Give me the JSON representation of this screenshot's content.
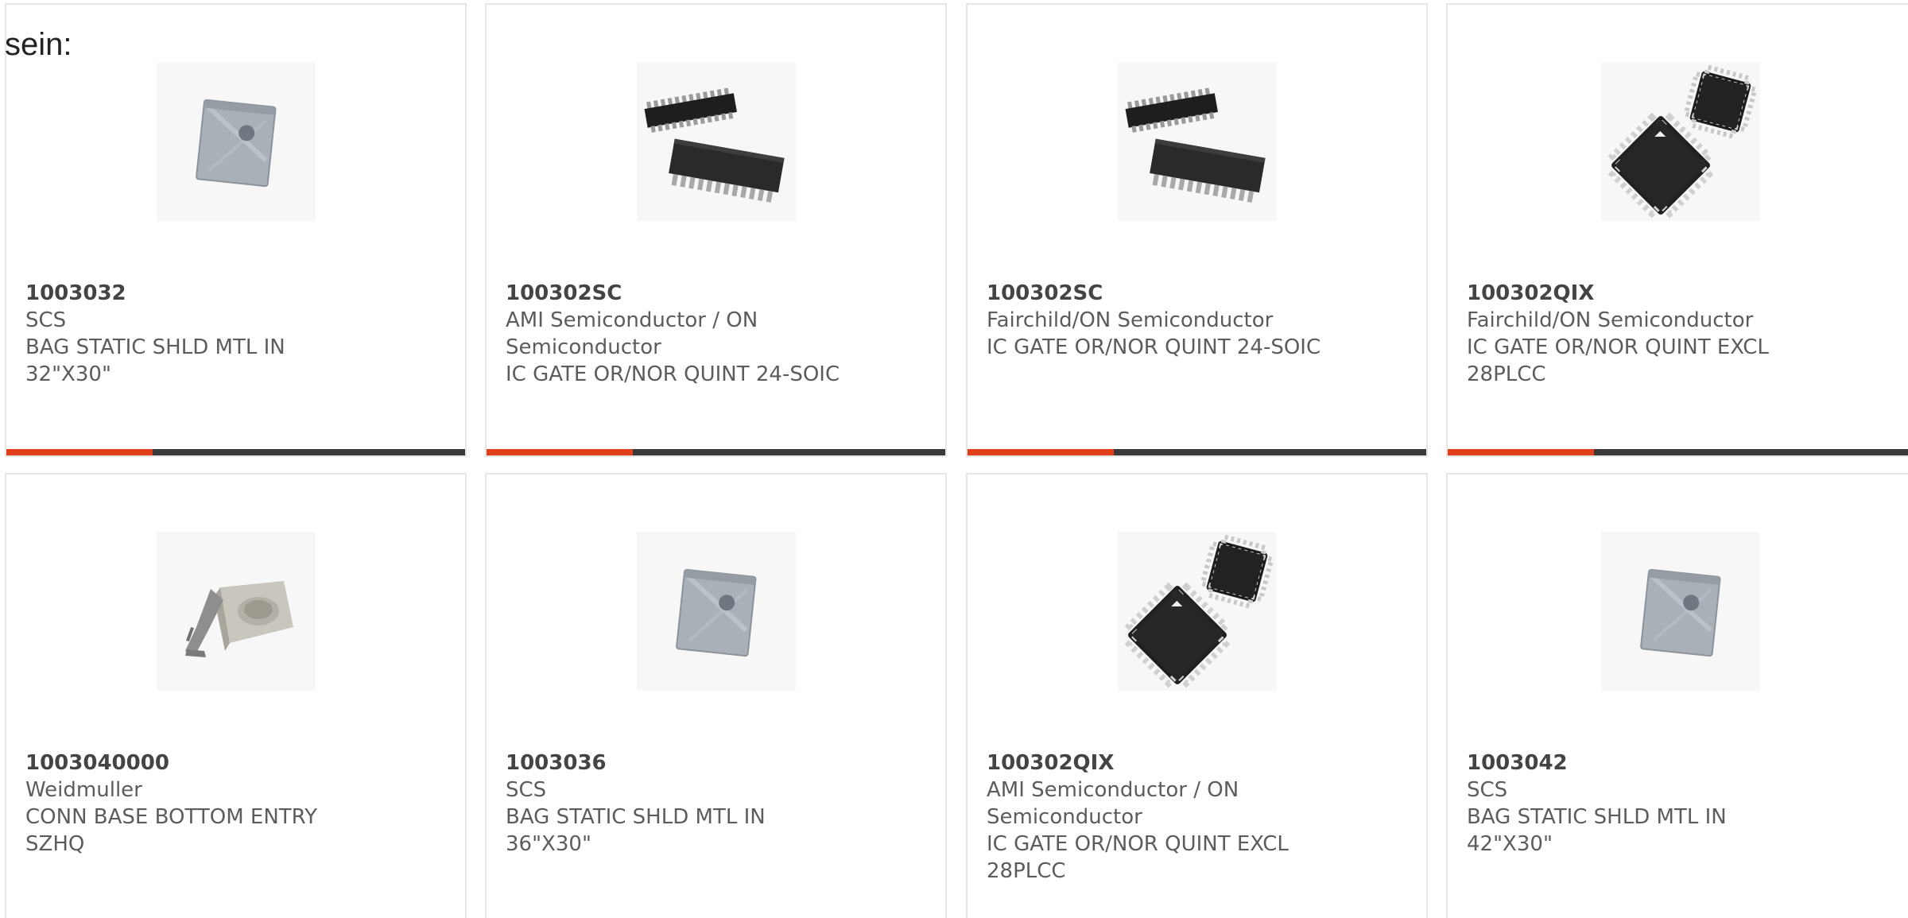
{
  "lead_text": "sein:",
  "colors": {
    "accent": "#e2401c",
    "bar": "#3a3a3a",
    "border": "#e6e6e6"
  },
  "products": [
    {
      "part_number": "1003032",
      "manufacturer": "SCS",
      "description": [
        "BAG STATIC SHLD MTL IN",
        "32\"X30\""
      ],
      "image_icon": "static-bag-icon"
    },
    {
      "part_number": "100302SC",
      "manufacturer": "AMI Semiconductor / ON Semiconductor",
      "description": [
        "IC GATE OR/NOR QUINT 24-SOIC"
      ],
      "image_icon": "soic-chip-icon"
    },
    {
      "part_number": "100302SC",
      "manufacturer": "Fairchild/ON Semiconductor",
      "description": [
        "IC GATE OR/NOR QUINT 24-SOIC"
      ],
      "image_icon": "soic-chip-icon"
    },
    {
      "part_number": "100302QIX",
      "manufacturer": "Fairchild/ON Semiconductor",
      "description": [
        "IC GATE OR/NOR QUINT EXCL",
        "28PLCC"
      ],
      "image_icon": "plcc-chip-icon"
    },
    {
      "part_number": "1003040000",
      "manufacturer": "Weidmuller",
      "description": [
        "CONN BASE BOTTOM ENTRY",
        "SZHQ"
      ],
      "image_icon": "connector-base-icon"
    },
    {
      "part_number": "1003036",
      "manufacturer": "SCS",
      "description": [
        "BAG STATIC SHLD MTL IN",
        "36\"X30\""
      ],
      "image_icon": "static-bag-icon"
    },
    {
      "part_number": "100302QIX",
      "manufacturer": "AMI Semiconductor / ON Semiconductor",
      "description": [
        "IC GATE OR/NOR QUINT EXCL",
        "28PLCC"
      ],
      "image_icon": "plcc-chip-icon"
    },
    {
      "part_number": "1003042",
      "manufacturer": "SCS",
      "description": [
        "BAG STATIC SHLD MTL IN",
        "42\"X30\""
      ],
      "image_icon": "static-bag-icon"
    }
  ]
}
